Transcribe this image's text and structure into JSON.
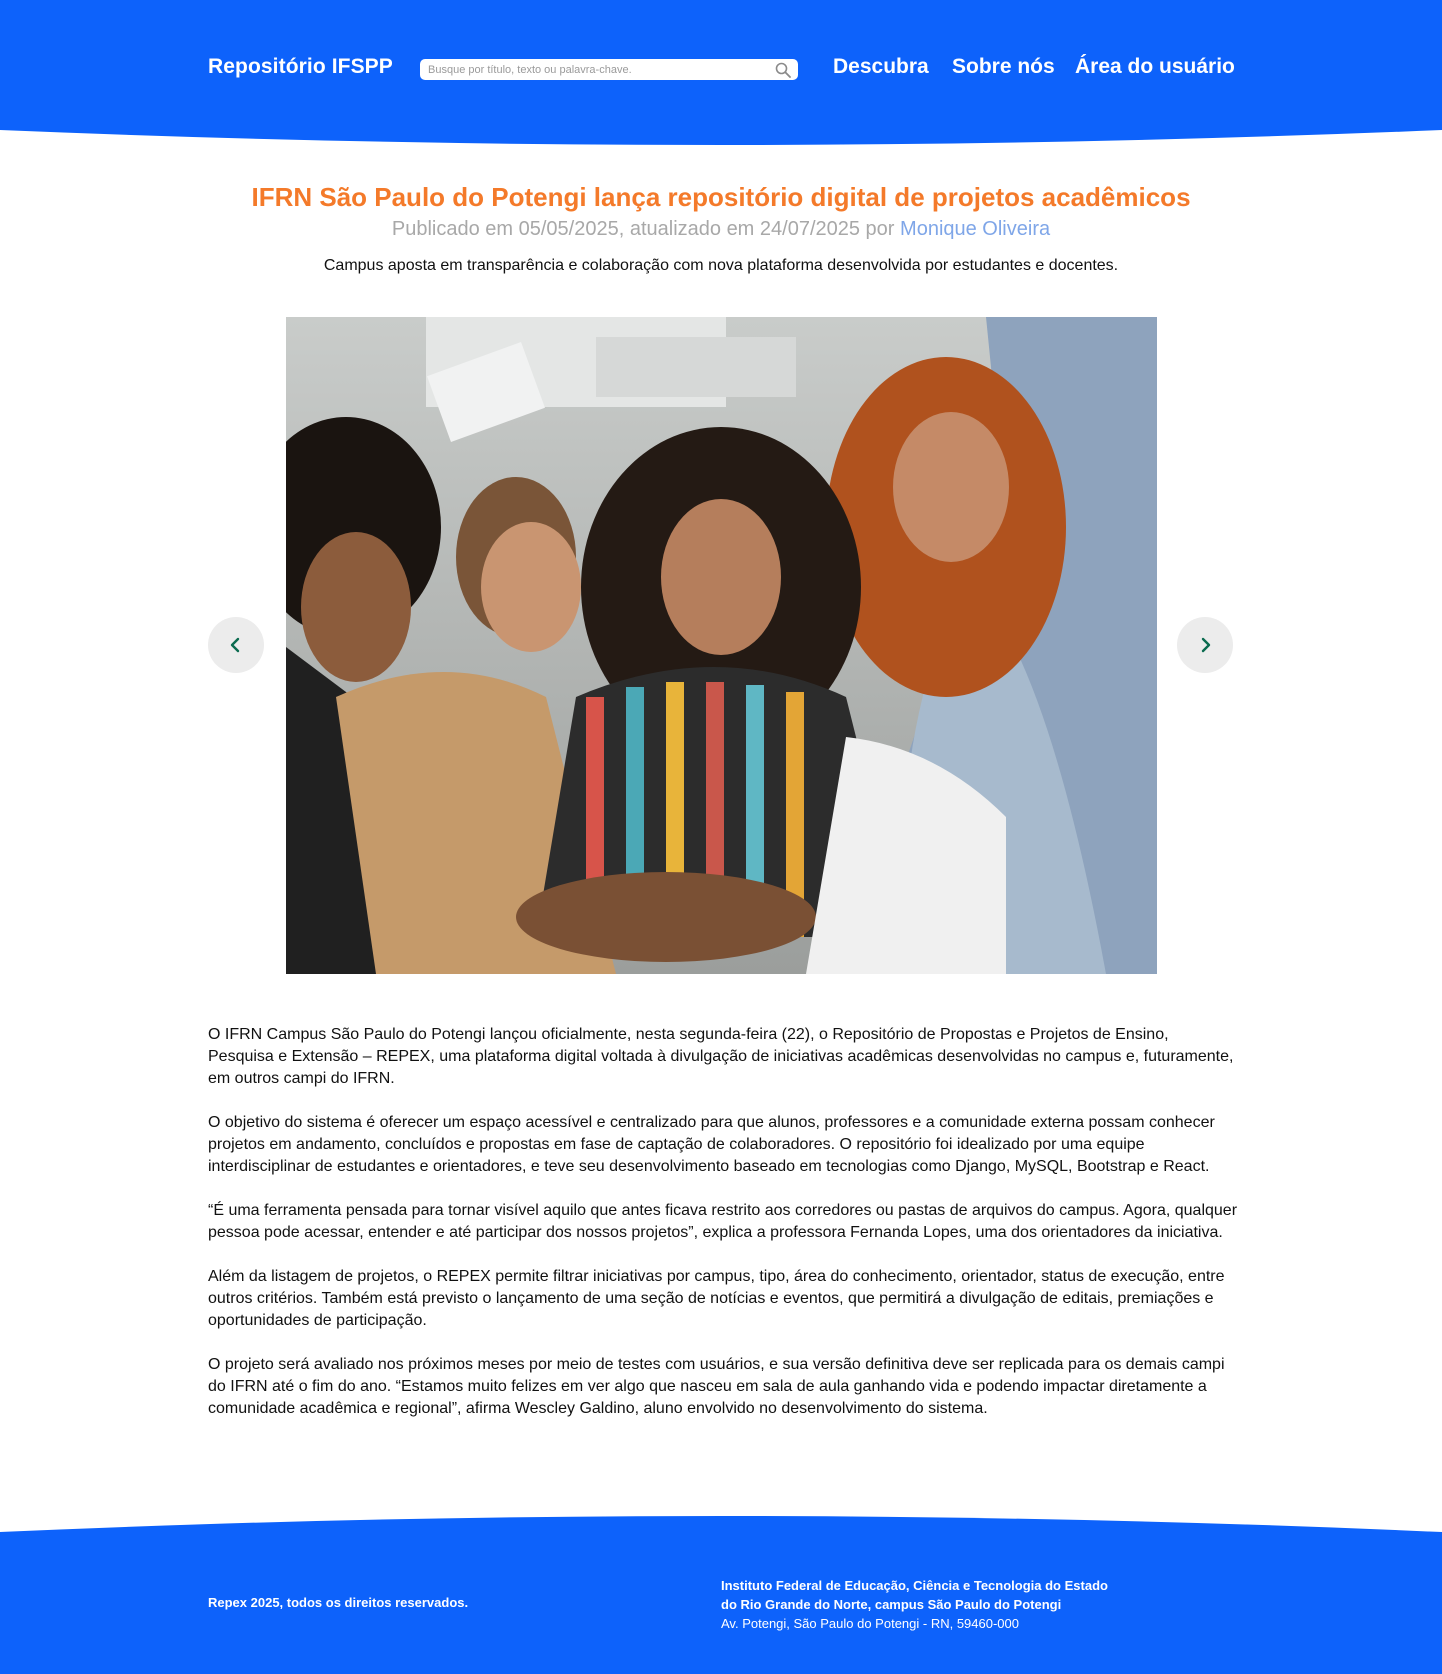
{
  "header": {
    "brand": "Repositório IFSPP",
    "search_placeholder": "Busque por título, texto ou palavra-chave.",
    "nav": [
      "Descubra",
      "Sobre nós",
      "Área do usuário"
    ],
    "color": "#0d62fb"
  },
  "article": {
    "title": "IFRN São Paulo do Potengi lança repositório digital de projetos acadêmicos",
    "meta_prefix": "Publicado em 05/05/2025, atualizado em 24/07/2025 por",
    "author": "Monique Oliveira",
    "subtitle": "Campus aposta em transparência e colaboração com nova plataforma desenvolvida por estudantes e docentes.",
    "title_color": "#f47a2a",
    "paragraphs": [
      "O IFRN Campus São Paulo do Potengi lançou oficialmente, nesta segunda-feira (22), o Repositório de Propostas e Projetos de Ensino, Pesquisa e Extensão – REPEX, uma plataforma digital voltada à divulgação de iniciativas acadêmicas desenvolvidas no campus e, futuramente, em outros campi do IFRN.",
      "O objetivo do sistema é oferecer um espaço acessível e centralizado para que alunos, professores e a comunidade externa possam conhecer projetos em andamento, concluídos e propostas em fase de captação de colaboradores. O repositório foi idealizado por uma equipe interdisciplinar de estudantes e orientadores, e teve seu desenvolvimento baseado em tecnologias como Django, MySQL, Bootstrap e React.",
      "“É uma ferramenta pensada para tornar visível aquilo que antes ficava restrito aos corredores ou pastas de arquivos do campus. Agora, qualquer pessoa pode acessar, entender e até participar dos nossos projetos”, explica a professora Fernanda Lopes, uma dos orientadores da iniciativa.",
      "Além da listagem de projetos, o REPEX permite filtrar iniciativas por campus, tipo, área do conhecimento, orientador, status de execução, entre outros critérios. Também está previsto o lançamento de uma seção de notícias e eventos, que permitirá a divulgação de editais, premiações e oportunidades de participação.",
      "O projeto será avaliado nos próximos meses por meio de testes com usuários, e sua versão definitiva deve ser replicada para os demais campi do IFRN até o fim do ano. “Estamos muito felizes em ver algo que nasceu em sala de aula ganhando vida e podendo impactar diretamente a comunidade acadêmica e regional”, afirma Wescley Galdino, aluno envolvido no desenvolvimento do sistema."
    ]
  },
  "carousel": {
    "image": "group-photo",
    "prev_icon": "chevron-left-icon",
    "next_icon": "chevron-right-icon",
    "arrow_color": "#0b6b4f"
  },
  "footer": {
    "copyright": "Repex 2025, todos os direitos reservados.",
    "institution_line1": "Instituto Federal de Educação, Ciência e Tecnologia do Estado",
    "institution_line2": "do Rio Grande do Norte, campus São Paulo do Potengi",
    "address": "Av. Potengi, São Paulo do Potengi - RN, 59460-000"
  }
}
